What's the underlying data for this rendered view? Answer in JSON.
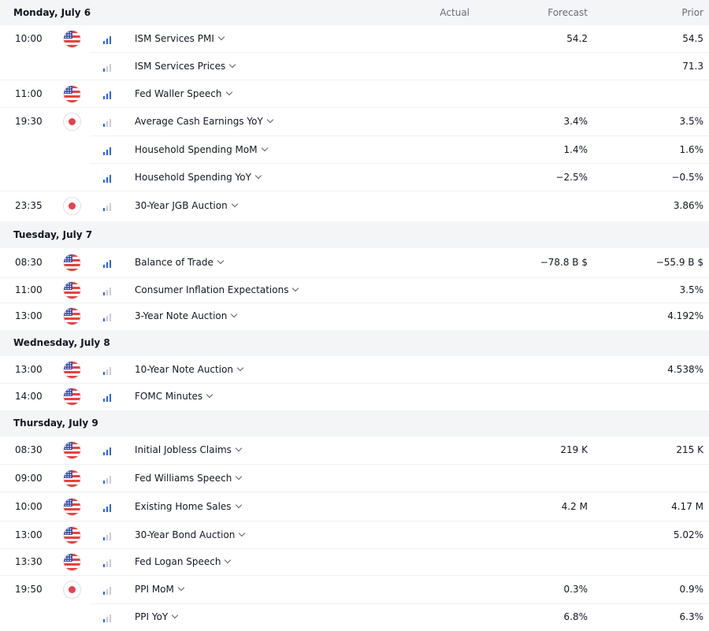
{
  "columns": {
    "actual": "Actual",
    "forecast": "Forecast",
    "prior": "Prior"
  },
  "days": [
    {
      "title": "Monday, July 6",
      "events": [
        {
          "time": "10:00",
          "country": "us",
          "importance": 3,
          "name": "ISM Services PMI",
          "actual": "",
          "forecast": "54.2",
          "prior": "54.5"
        },
        {
          "time": "",
          "country": "",
          "importance": 1,
          "name": "ISM Services Prices",
          "actual": "",
          "forecast": "",
          "prior": "71.3"
        },
        {
          "time": "11:00",
          "country": "us",
          "importance": 3,
          "name": "Fed Waller Speech",
          "actual": "",
          "forecast": "",
          "prior": ""
        },
        {
          "time": "19:30",
          "country": "jp",
          "importance": 1,
          "name": "Average Cash Earnings YoY",
          "actual": "",
          "forecast": "3.4%",
          "prior": "3.5%"
        },
        {
          "time": "",
          "country": "",
          "importance": 3,
          "name": "Household Spending MoM",
          "actual": "",
          "forecast": "1.4%",
          "prior": "1.6%"
        },
        {
          "time": "",
          "country": "",
          "importance": 3,
          "name": "Household Spending YoY",
          "actual": "",
          "forecast": "−2.5%",
          "prior": "−0.5%"
        },
        {
          "time": "23:35",
          "country": "jp",
          "importance": 1,
          "name": "30-Year JGB Auction",
          "actual": "",
          "forecast": "",
          "prior": "3.86%"
        }
      ]
    },
    {
      "title": "Tuesday, July 7",
      "events": [
        {
          "time": "08:30",
          "country": "us",
          "importance": 3,
          "name": "Balance of Trade",
          "actual": "",
          "forecast": "−78.8 B $",
          "prior": "−55.9 B $"
        },
        {
          "time": "11:00",
          "country": "us",
          "importance": 1,
          "name": "Consumer Inflation Expectations",
          "actual": "",
          "forecast": "",
          "prior": "3.5%"
        },
        {
          "time": "13:00",
          "country": "us",
          "importance": 1,
          "name": "3-Year Note Auction",
          "actual": "",
          "forecast": "",
          "prior": "4.192%"
        }
      ]
    },
    {
      "title": "Wednesday, July 8",
      "events": [
        {
          "time": "13:00",
          "country": "us",
          "importance": 1,
          "name": "10-Year Note Auction",
          "actual": "",
          "forecast": "",
          "prior": "4.538%"
        },
        {
          "time": "14:00",
          "country": "us",
          "importance": 3,
          "name": "FOMC Minutes",
          "actual": "",
          "forecast": "",
          "prior": ""
        }
      ]
    },
    {
      "title": "Thursday, July 9",
      "events": [
        {
          "time": "08:30",
          "country": "us",
          "importance": 3,
          "name": "Initial Jobless Claims",
          "actual": "",
          "forecast": "219 K",
          "prior": "215 K"
        },
        {
          "time": "09:00",
          "country": "us",
          "importance": 1,
          "name": "Fed Williams Speech",
          "actual": "",
          "forecast": "",
          "prior": ""
        },
        {
          "time": "10:00",
          "country": "us",
          "importance": 3,
          "name": "Existing Home Sales",
          "actual": "",
          "forecast": "4.2 M",
          "prior": "4.17 M"
        },
        {
          "time": "13:00",
          "country": "us",
          "importance": 1,
          "name": "30-Year Bond Auction",
          "actual": "",
          "forecast": "",
          "prior": "5.02%"
        },
        {
          "time": "13:30",
          "country": "us",
          "importance": 1,
          "name": "Fed Logan Speech",
          "actual": "",
          "forecast": "",
          "prior": ""
        },
        {
          "time": "19:50",
          "country": "jp",
          "importance": 1,
          "name": "PPI MoM",
          "actual": "",
          "forecast": "0.3%",
          "prior": "0.9%"
        },
        {
          "time": "",
          "country": "",
          "importance": 1,
          "name": "PPI YoY",
          "actual": "",
          "forecast": "6.8%",
          "prior": "6.3%"
        }
      ]
    }
  ]
}
